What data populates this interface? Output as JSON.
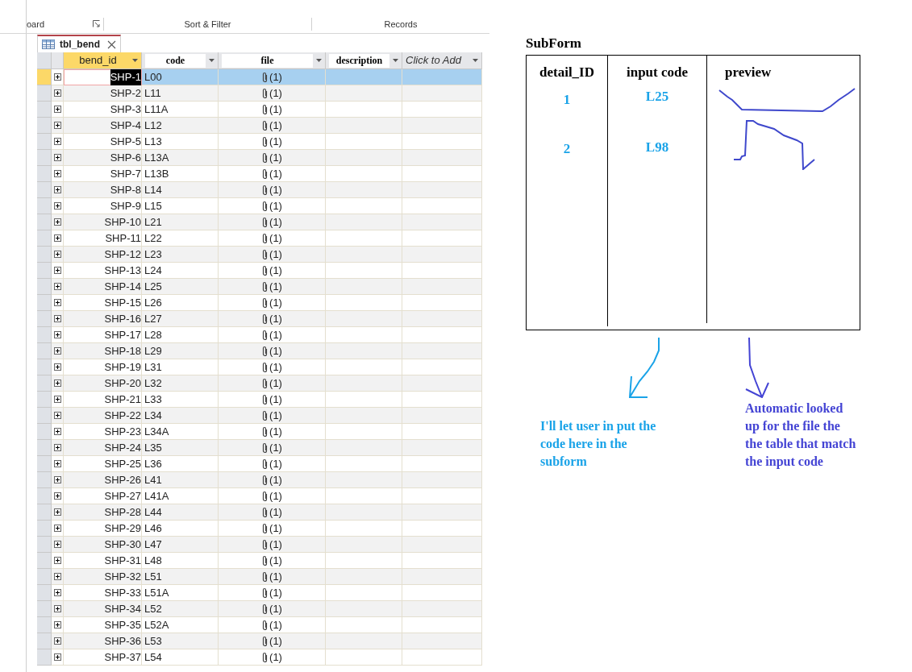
{
  "ribbon": {
    "groups": [
      {
        "label": "oard",
        "launcher": true
      },
      {
        "label": "Sort & Filter",
        "launcher": false
      },
      {
        "label": "Records",
        "launcher": false
      }
    ]
  },
  "tab": {
    "label": "tbl_bend",
    "selected": true
  },
  "table": {
    "columns": [
      {
        "label": "bend_id",
        "selected": true,
        "kind": "plain"
      },
      {
        "label": "code",
        "selected": false,
        "kind": "boxed"
      },
      {
        "label": "file",
        "selected": false,
        "kind": "boxed"
      },
      {
        "label": "description",
        "selected": false,
        "kind": "boxed"
      },
      {
        "label": "Click to Add",
        "selected": false,
        "kind": "add"
      }
    ],
    "rows": [
      {
        "bend_id": "SHP-1",
        "code": "L00",
        "file": "(1)",
        "selected": true
      },
      {
        "bend_id": "SHP-2",
        "code": "L11",
        "file": "(1)",
        "selected": false
      },
      {
        "bend_id": "SHP-3",
        "code": "L11A",
        "file": "(1)",
        "selected": false
      },
      {
        "bend_id": "SHP-4",
        "code": "L12",
        "file": "(1)",
        "selected": false
      },
      {
        "bend_id": "SHP-5",
        "code": "L13",
        "file": "(1)",
        "selected": false
      },
      {
        "bend_id": "SHP-6",
        "code": "L13A",
        "file": "(1)",
        "selected": false
      },
      {
        "bend_id": "SHP-7",
        "code": "L13B",
        "file": "(1)",
        "selected": false
      },
      {
        "bend_id": "SHP-8",
        "code": "L14",
        "file": "(1)",
        "selected": false
      },
      {
        "bend_id": "SHP-9",
        "code": "L15",
        "file": "(1)",
        "selected": false
      },
      {
        "bend_id": "SHP-10",
        "code": "L21",
        "file": "(1)",
        "selected": false
      },
      {
        "bend_id": "SHP-11",
        "code": "L22",
        "file": "(1)",
        "selected": false
      },
      {
        "bend_id": "SHP-12",
        "code": "L23",
        "file": "(1)",
        "selected": false
      },
      {
        "bend_id": "SHP-13",
        "code": "L24",
        "file": "(1)",
        "selected": false
      },
      {
        "bend_id": "SHP-14",
        "code": "L25",
        "file": "(1)",
        "selected": false
      },
      {
        "bend_id": "SHP-15",
        "code": "L26",
        "file": "(1)",
        "selected": false
      },
      {
        "bend_id": "SHP-16",
        "code": "L27",
        "file": "(1)",
        "selected": false
      },
      {
        "bend_id": "SHP-17",
        "code": "L28",
        "file": "(1)",
        "selected": false
      },
      {
        "bend_id": "SHP-18",
        "code": "L29",
        "file": "(1)",
        "selected": false
      },
      {
        "bend_id": "SHP-19",
        "code": "L31",
        "file": "(1)",
        "selected": false
      },
      {
        "bend_id": "SHP-20",
        "code": "L32",
        "file": "(1)",
        "selected": false
      },
      {
        "bend_id": "SHP-21",
        "code": "L33",
        "file": "(1)",
        "selected": false
      },
      {
        "bend_id": "SHP-22",
        "code": "L34",
        "file": "(1)",
        "selected": false
      },
      {
        "bend_id": "SHP-23",
        "code": "L34A",
        "file": "(1)",
        "selected": false
      },
      {
        "bend_id": "SHP-24",
        "code": "L35",
        "file": "(1)",
        "selected": false
      },
      {
        "bend_id": "SHP-25",
        "code": "L36",
        "file": "(1)",
        "selected": false
      },
      {
        "bend_id": "SHP-26",
        "code": "L41",
        "file": "(1)",
        "selected": false
      },
      {
        "bend_id": "SHP-27",
        "code": "L41A",
        "file": "(1)",
        "selected": false
      },
      {
        "bend_id": "SHP-28",
        "code": "L44",
        "file": "(1)",
        "selected": false
      },
      {
        "bend_id": "SHP-29",
        "code": "L46",
        "file": "(1)",
        "selected": false
      },
      {
        "bend_id": "SHP-30",
        "code": "L47",
        "file": "(1)",
        "selected": false
      },
      {
        "bend_id": "SHP-31",
        "code": "L48",
        "file": "(1)",
        "selected": false
      },
      {
        "bend_id": "SHP-32",
        "code": "L51",
        "file": "(1)",
        "selected": false
      },
      {
        "bend_id": "SHP-33",
        "code": "L51A",
        "file": "(1)",
        "selected": false
      },
      {
        "bend_id": "SHP-34",
        "code": "L52",
        "file": "(1)",
        "selected": false
      },
      {
        "bend_id": "SHP-35",
        "code": "L52A",
        "file": "(1)",
        "selected": false
      },
      {
        "bend_id": "SHP-36",
        "code": "L53",
        "file": "(1)",
        "selected": false
      },
      {
        "bend_id": "SHP-37",
        "code": "L54",
        "file": "(1)",
        "selected": false
      }
    ]
  },
  "subform": {
    "title": "SubForm",
    "columns": [
      "detail_ID",
      "input code",
      "preview"
    ],
    "rows": [
      {
        "detail_id": "1",
        "input_code": "L25"
      },
      {
        "detail_id": "2",
        "input_code": "L98"
      }
    ]
  },
  "notes": [
    {
      "text": "I'll let user in put the code here in the subform",
      "color": "#1aa3e8"
    },
    {
      "text": "Automatic looked up for the file the the table that match the input code",
      "color": "#4444d4"
    }
  ]
}
